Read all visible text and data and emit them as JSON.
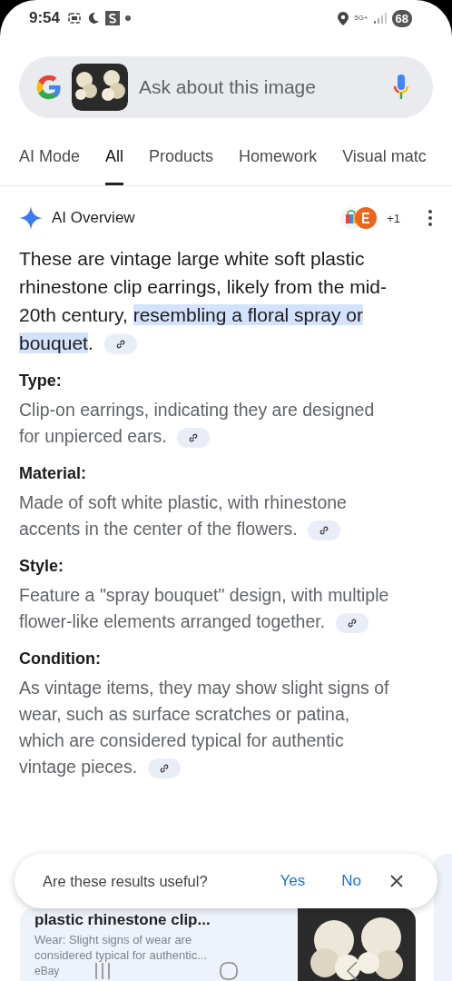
{
  "status_bar": {
    "time": "9:54",
    "network": "5G+",
    "battery": "68"
  },
  "search": {
    "placeholder": "Ask about this image"
  },
  "tabs": [
    {
      "label": "AI Mode",
      "selected": false
    },
    {
      "label": "All",
      "selected": true
    },
    {
      "label": "Products",
      "selected": false
    },
    {
      "label": "Homework",
      "selected": false
    },
    {
      "label": "Visual matc",
      "selected": false
    }
  ],
  "overview": {
    "title": "AI Overview",
    "sources_more": "+1",
    "summary": [
      {
        "text": "These are vintage large white soft plastic rhinestone clip earrings, likely from the mid-20th century, ",
        "highlighted": false
      },
      {
        "text": "resembling a floral spray or bouquet",
        "highlighted": true
      },
      {
        "text": ".",
        "highlighted": false
      }
    ],
    "sections": [
      {
        "heading": "Type:",
        "text": "Clip-on earrings, indicating they are designed for unpierced ears."
      },
      {
        "heading": "Material:",
        "text": "Made of soft white plastic, with rhinestone accents in the center of the flowers."
      },
      {
        "heading": "Style:",
        "text": "Feature a \"spray bouquet\" design, with multiple flower-like elements arranged together."
      },
      {
        "heading": "Condition:",
        "text": "As vintage items, they may show slight signs of wear, such as surface scratches or patina, which are considered typical for authentic vintage pieces."
      }
    ]
  },
  "feedback": {
    "question": "Are these results useful?",
    "yes": "Yes",
    "no": "No"
  },
  "result_card": {
    "title": "plastic rhinestone clip...",
    "snippet": "Wear: Slight signs of wear are considered typical for authentic...",
    "source": "eBay"
  }
}
